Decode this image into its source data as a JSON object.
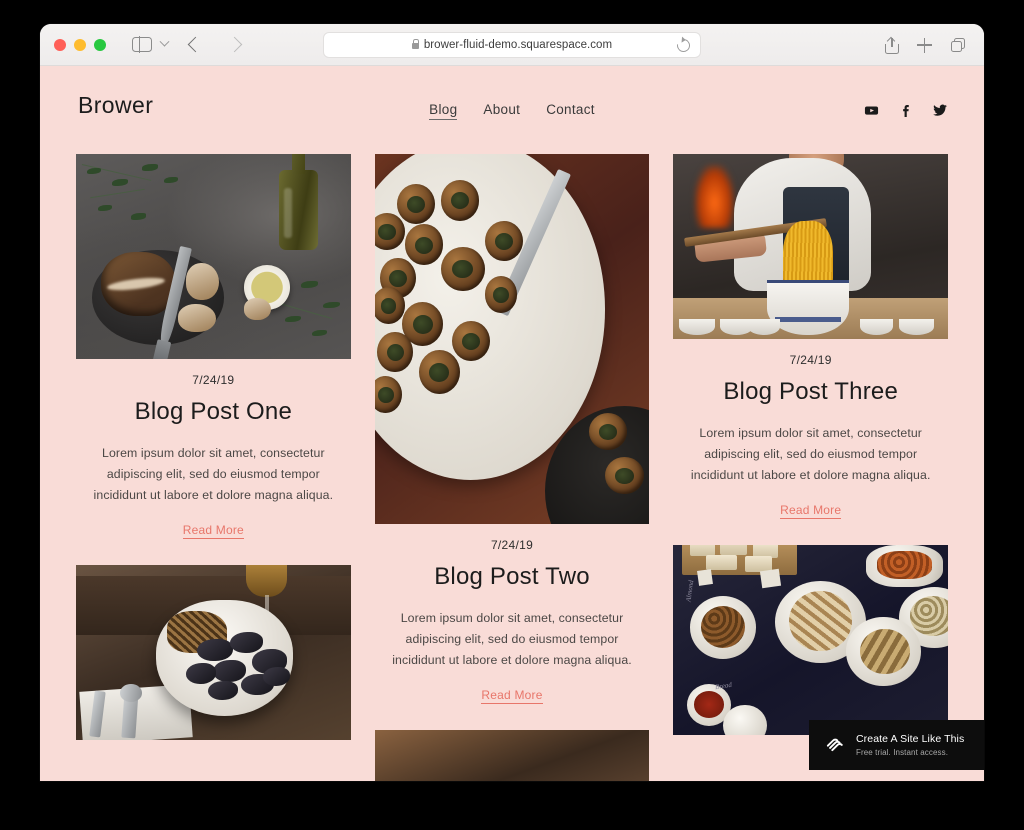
{
  "browser": {
    "url": "brower-fluid-demo.squarespace.com",
    "lock_icon": "lock-icon",
    "reload_icon": "reload-icon",
    "back_icon": "back-arrow-icon",
    "forward_icon": "forward-arrow-icon",
    "sidebar_icon": "sidebar-toggle-icon",
    "share_icon": "share-icon",
    "new_tab_icon": "plus-icon",
    "tab_overview_icon": "tab-overview-icon"
  },
  "site": {
    "logo": "Brower",
    "background_color": "#F9DCD7",
    "accent_color": "#E8766A",
    "nav": [
      {
        "label": "Blog",
        "active": true
      },
      {
        "label": "About",
        "active": false
      },
      {
        "label": "Contact",
        "active": false
      }
    ],
    "social": [
      {
        "name": "youtube-icon",
        "label": "YouTube"
      },
      {
        "name": "facebook-icon",
        "label": "Facebook"
      },
      {
        "name": "twitter-icon",
        "label": "Twitter"
      }
    ]
  },
  "posts": [
    {
      "date": "7/24/19",
      "title": "Blog Post One",
      "excerpt": "Lorem ipsum dolor sit amet, consectetur adipiscing elit, sed do eiusmod tempor incididunt ut labore et dolore magna aliqua.",
      "read_more": "Read More",
      "image_alt": "bread-and-olive-oil-on-stone"
    },
    {
      "date": "7/24/19",
      "title": "Blog Post Two",
      "excerpt": "Lorem ipsum dolor sit amet, consectetur adipiscing elit, sed do eiusmod tempor incididunt ut labore et dolore magna aliqua.",
      "read_more": "Read More",
      "image_alt": "escargot-on-white-plate"
    },
    {
      "date": "7/24/19",
      "title": "Blog Post Three",
      "excerpt": "Lorem ipsum dolor sit amet, consectetur adipiscing elit, sed do eiusmod tempor incididunt ut labore et dolore magna aliqua.",
      "read_more": "Read More",
      "image_alt": "chef-lifting-noodles"
    },
    {
      "image_alt": "mussels-in-white-bowl"
    },
    {
      "image_alt": "dark-navy-table-spread"
    }
  ],
  "promo": {
    "title": "Create A Site Like This",
    "subtitle": "Free trial. Instant access.",
    "logo": "squarespace-logo-icon"
  }
}
